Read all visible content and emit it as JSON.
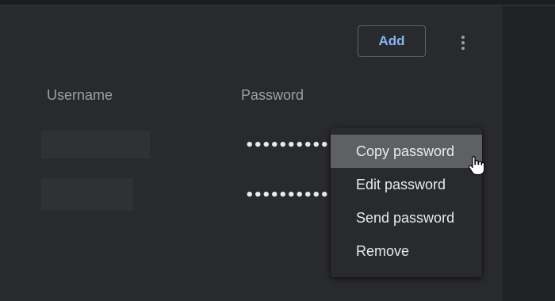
{
  "header": {
    "add_label": "Add",
    "more_icon": "more-vert-icon"
  },
  "table": {
    "columns": [
      "Username",
      "Password"
    ],
    "rows": [
      {
        "username": "",
        "password": "••••••••••"
      },
      {
        "username": "",
        "password": "••••••••••"
      }
    ]
  },
  "context_menu": {
    "items": [
      {
        "label": "Copy password",
        "hovered": true
      },
      {
        "label": "Edit password",
        "hovered": false
      },
      {
        "label": "Send password",
        "hovered": false
      },
      {
        "label": "Remove",
        "hovered": false
      }
    ]
  },
  "colors": {
    "accent": "#8ab4f8",
    "panel": "#292a2d",
    "hover": "#5f6063"
  }
}
